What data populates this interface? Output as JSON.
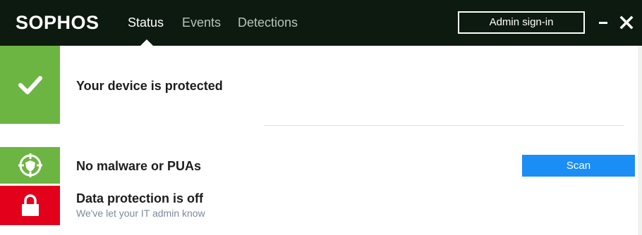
{
  "header": {
    "logo": "SOPHOS",
    "tabs": [
      {
        "label": "Status",
        "active": true
      },
      {
        "label": "Events",
        "active": false
      },
      {
        "label": "Detections",
        "active": false
      }
    ],
    "admin_button": "Admin sign-in",
    "minimize_icon": "minimize-icon",
    "close_icon": "close-icon"
  },
  "status": {
    "main": {
      "title": "Your device is protected",
      "icon": "checkmark-icon",
      "color": "#6cb542"
    },
    "malware": {
      "title": "No malware or PUAs",
      "icon": "target-shield-icon",
      "color": "#6cb542",
      "action": "Scan"
    },
    "data_protection": {
      "title": "Data protection is off",
      "subtitle": "We've let your IT admin know",
      "icon": "padlock-icon",
      "color": "#e3001b"
    }
  },
  "colors": {
    "header_bg": "#0d1a0f",
    "accent_blue": "#1b8ef5"
  }
}
